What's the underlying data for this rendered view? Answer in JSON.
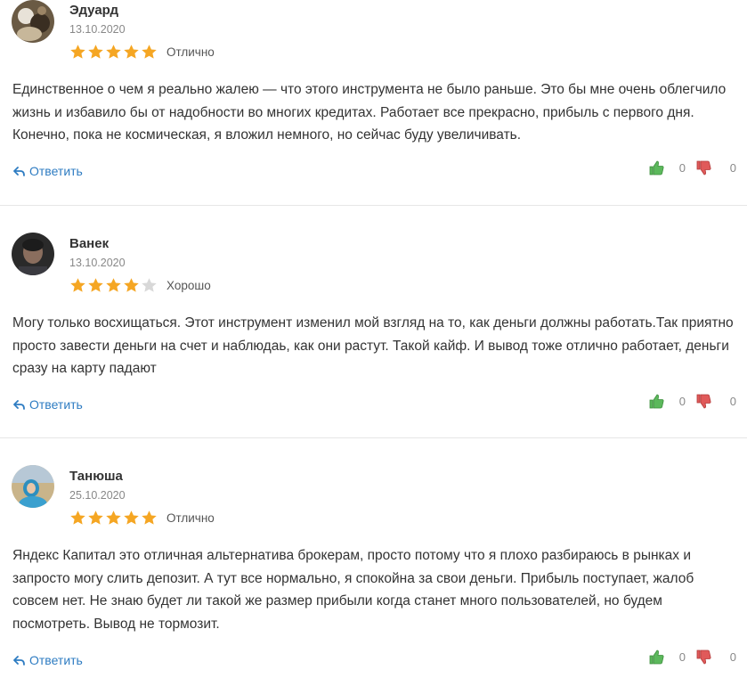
{
  "reviews": [
    {
      "author": "Эдуард",
      "date": "13.10.2020",
      "rating": 5,
      "rating_max": 5,
      "rating_label": "Отлично",
      "text": "Единственное о чем я реально жалею — что этого инструмента не было раньше. Это бы мне очень облегчило жизнь и избавило бы от надобности во многих кредитах. Работает все прекрасно, прибыль с первого дня. Конечно, пока не космическая, я вложил немного, но сейчас буду увеличивать.",
      "reply_label": "Ответить",
      "likes": "0",
      "dislikes": "0"
    },
    {
      "author": "Ванек",
      "date": "13.10.2020",
      "rating": 4,
      "rating_max": 5,
      "rating_label": "Хорошо",
      "text": "Могу только восхищаться. Этот инструмент изменил мой взгляд на то, как деньги должны работать.Так приятно просто завести деньги на счет и наблюдаь, как они растут. Такой кайф. И вывод тоже отлично работает, деньги сразу на карту падают",
      "reply_label": "Ответить",
      "likes": "0",
      "dislikes": "0"
    },
    {
      "author": "Танюша",
      "date": "25.10.2020",
      "rating": 5,
      "rating_max": 5,
      "rating_label": "Отлично",
      "text": "Яндекс Капитал это отличная альтернатива брокерам, просто потому что я плохо разбираюсь в рынках и запросто могу слить депозит. А тут все нормально, я спокойна за свои деньги. Прибыль поступает, жалоб совсем нет. Не знаю будет ли такой же размер прибыли когда станет много пользователей, но будем посмотреть. Вывод не тормозит.",
      "reply_label": "Ответить",
      "likes": "0",
      "dislikes": "0"
    }
  ],
  "colors": {
    "star_filled": "#f5a623",
    "star_empty": "#d8d8d8",
    "link": "#2e7cc2",
    "thumb_up": "#5cb85c",
    "thumb_down": "#e05a5a"
  },
  "icons": {
    "star": "star-icon",
    "reply": "reply-arrow-icon",
    "like": "thumbs-up-icon",
    "dislike": "thumbs-down-icon"
  }
}
